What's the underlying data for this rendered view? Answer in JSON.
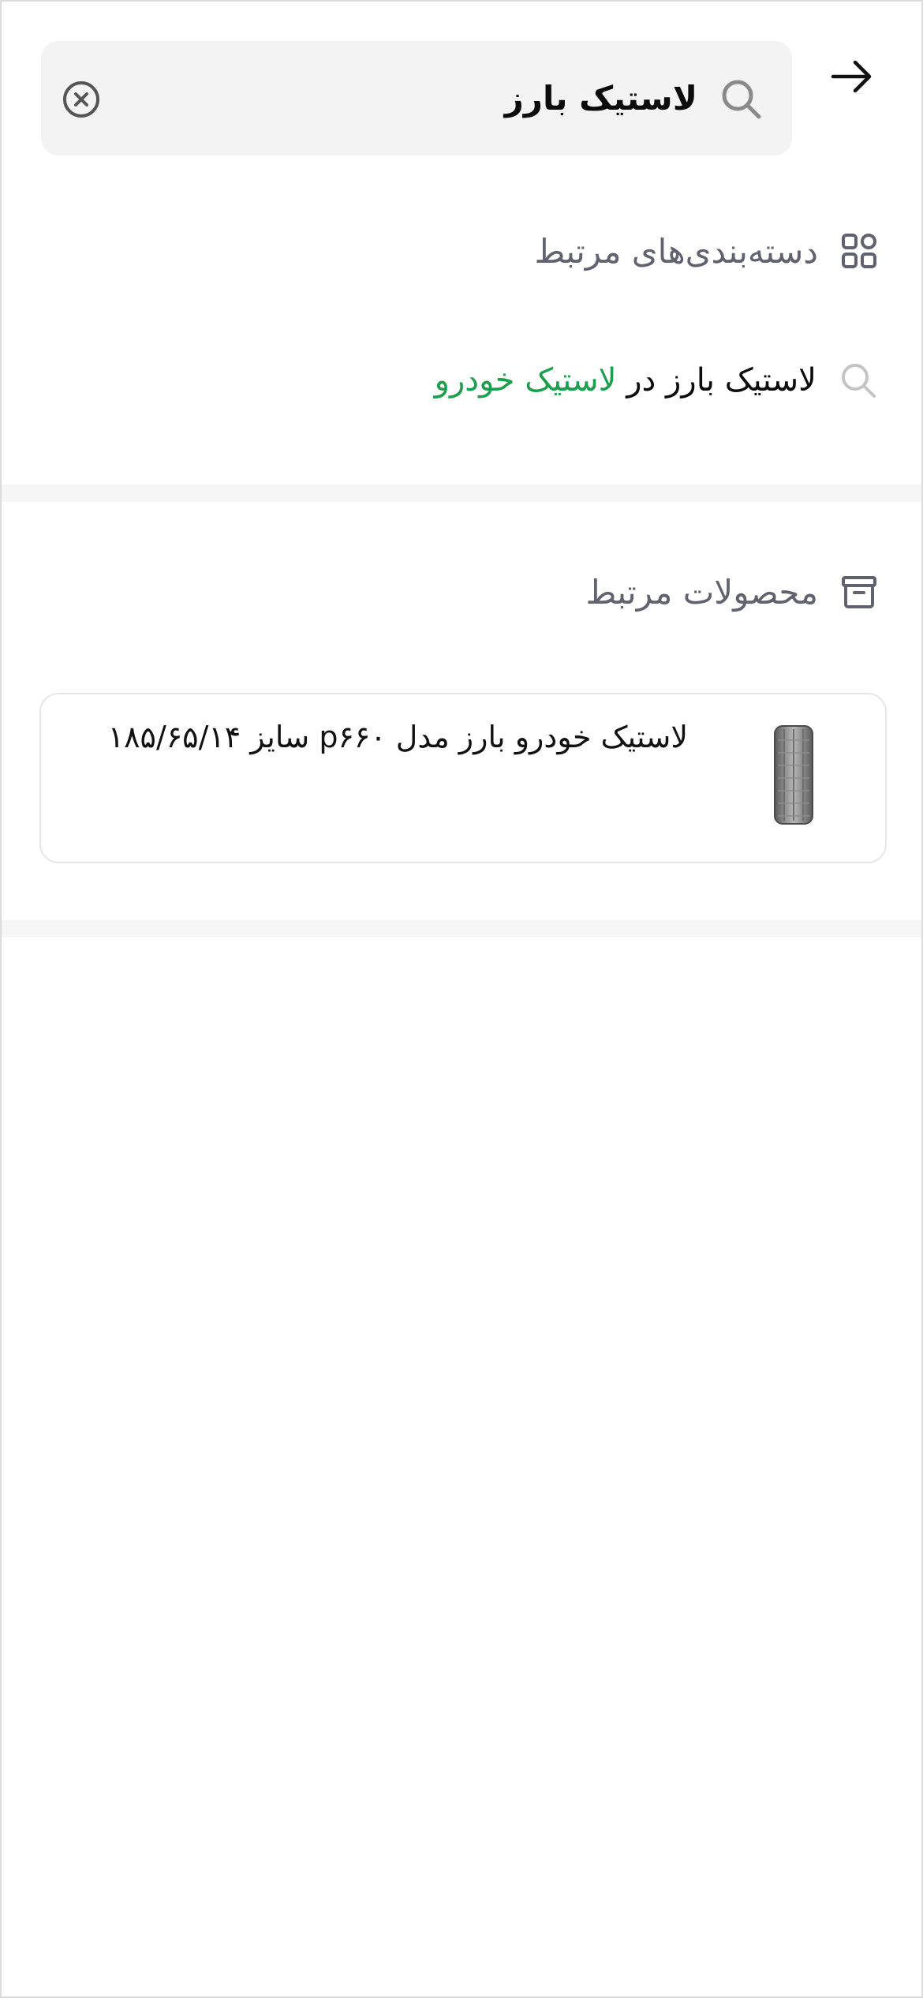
{
  "search": {
    "query": "لاستیک بارز",
    "placeholder": ""
  },
  "categories_section": {
    "title": "دسته‌بندی‌های مرتبط",
    "icon": "grid-icon"
  },
  "category_suggestion": {
    "prefix": "لاستیک بارز در ",
    "category": "لاستیک خودرو",
    "icon": "search-icon"
  },
  "products_section": {
    "title": "محصولات مرتبط",
    "icon": "archive-box-icon"
  },
  "products": [
    {
      "name": "لاستیک خودرو بارز مدل p۶۶۰ سایز ۱۸۵/۶۵/۱۴"
    }
  ],
  "colors": {
    "accent_green": "#1f9d4f",
    "muted_text": "#62626e",
    "search_bg": "#f3f3f3"
  }
}
